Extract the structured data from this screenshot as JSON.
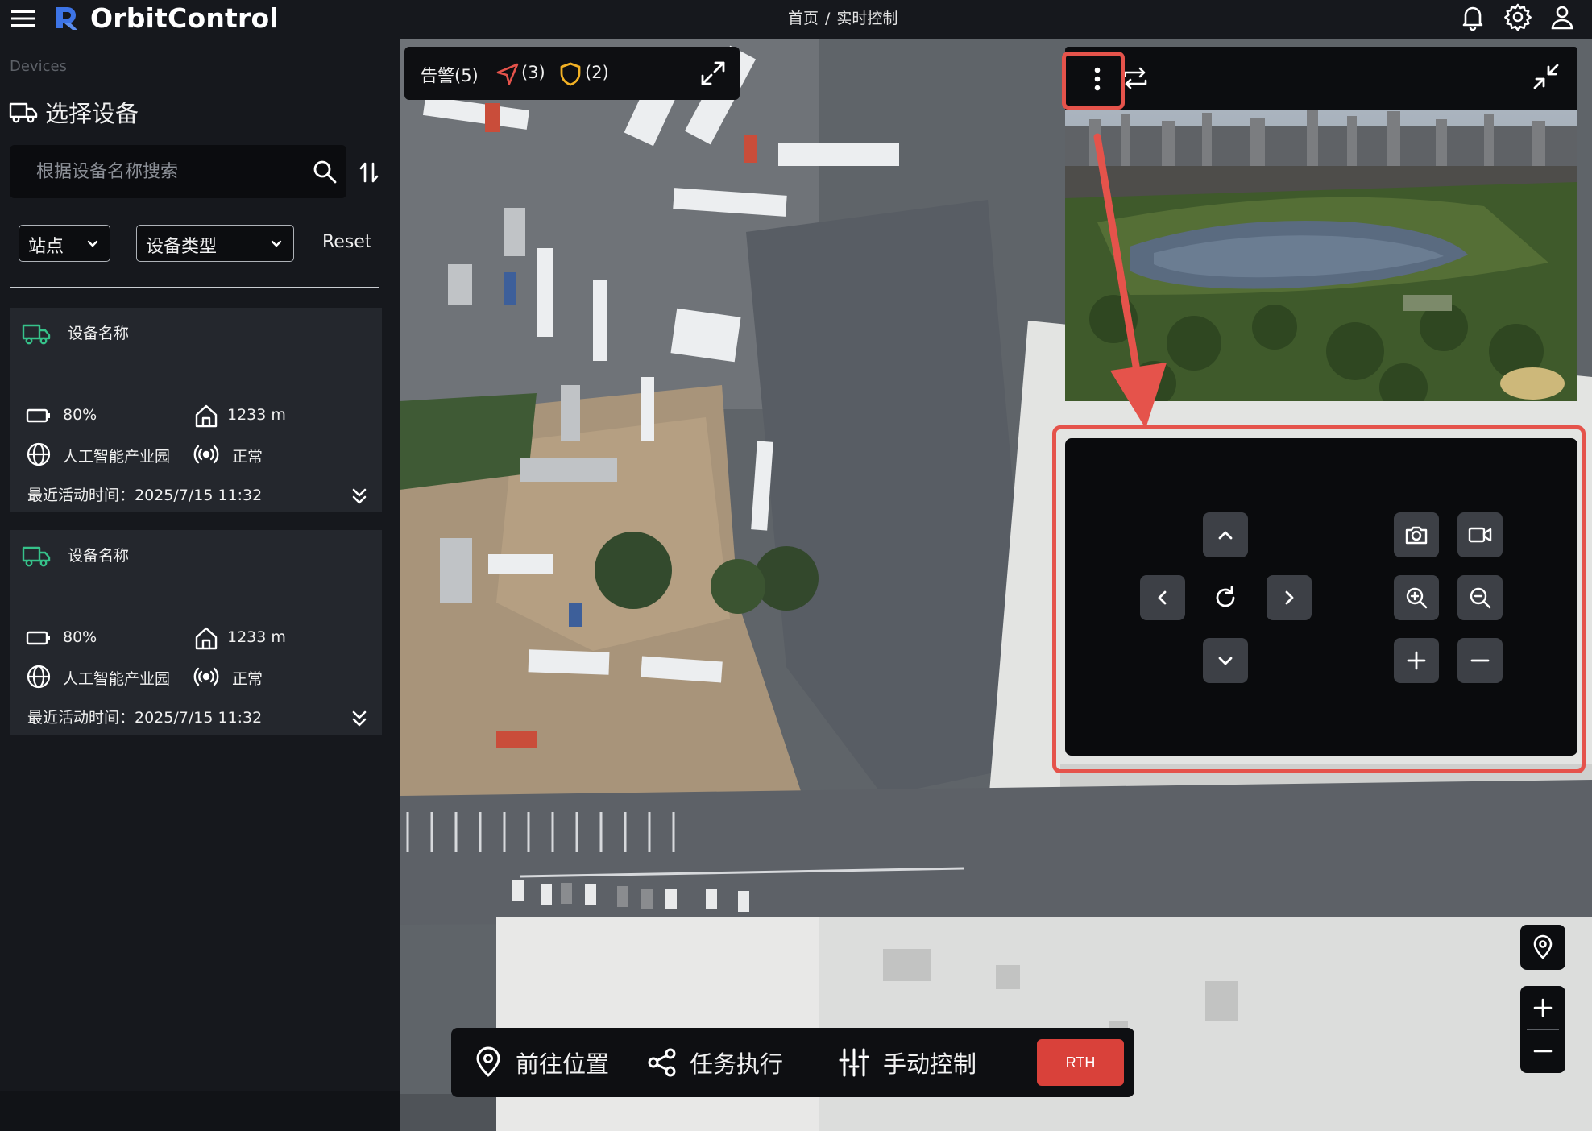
{
  "header": {
    "app_name": "OrbitControl",
    "breadcrumb": [
      "首页",
      "/",
      "实时控制"
    ],
    "icons": [
      "menu-icon",
      "logo",
      "bell-icon",
      "gear-icon",
      "user-icon"
    ]
  },
  "sidebar": {
    "section_label": "Devices",
    "title": "选择设备",
    "search_placeholder": "根据设备名称搜索",
    "filters": {
      "site": "站点",
      "device_type": "设备类型",
      "reset": "Reset"
    },
    "devices": [
      {
        "name": "设备名称",
        "battery": "80%",
        "altitude": "1233 m",
        "location": "人工智能产业园",
        "signal": "正常",
        "last_active": "最近活动时间：2025/7/15 11:32"
      },
      {
        "name": "设备名称",
        "battery": "80%",
        "altitude": "1233 m",
        "location": "人工智能产业园",
        "signal": "正常",
        "last_active": "最近活动时间：2025/7/15 11:32"
      }
    ]
  },
  "alerts": {
    "warning": "告警(5)",
    "nav": "(3)",
    "shield": "(2)"
  },
  "actions": {
    "goto": "前往位置",
    "mission": "任务执行",
    "manual": "手动控制",
    "rth": "RTH"
  },
  "colors": {
    "accent_green": "#36c28a",
    "annotation_red": "#e5534b",
    "rth_red": "#d9413a",
    "logo_blue": "#3d74e6"
  }
}
